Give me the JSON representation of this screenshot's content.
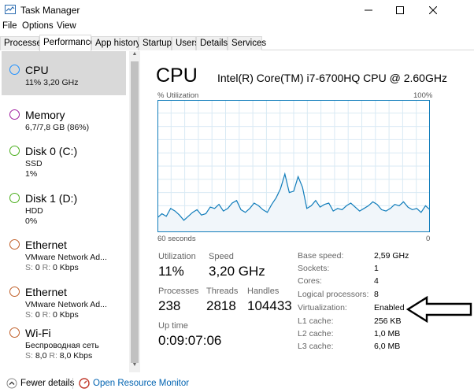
{
  "window": {
    "title": "Task Manager",
    "controls": {
      "minimize": "—",
      "maximize": "☐",
      "close": "✕"
    }
  },
  "menu": {
    "items": [
      "File",
      "Options",
      "View"
    ]
  },
  "tabs": [
    "Processes",
    "Performance",
    "App history",
    "Startup",
    "Users",
    "Details",
    "Services"
  ],
  "active_tab": "Performance",
  "sidebar": {
    "items": [
      {
        "title": "CPU",
        "sub1": "11%  3,20 GHz",
        "sub2": "",
        "color": "#1e90ff",
        "selected": true
      },
      {
        "title": "Memory",
        "sub1": "6,7/7,8 GB (86%)",
        "sub2": "",
        "color": "#a020a0"
      },
      {
        "title": "Disk 0 (C:)",
        "sub1": "SSD",
        "sub2": "1%",
        "color": "#4caf1e"
      },
      {
        "title": "Disk 1 (D:)",
        "sub1": "HDD",
        "sub2": "0%",
        "color": "#4caf1e"
      },
      {
        "title": "Ethernet",
        "sub1": "VMware Network Ad...",
        "sub2_label": "S:",
        "sub2_a": " 0  ",
        "sub2_label2": "R:",
        "sub2_b": " 0 Kbps",
        "color": "#c0602a"
      },
      {
        "title": "Ethernet",
        "sub1": "VMware Network Ad...",
        "sub2_label": "S:",
        "sub2_a": " 0  ",
        "sub2_label2": "R:",
        "sub2_b": " 0 Kbps",
        "color": "#c0602a"
      },
      {
        "title": "Wi-Fi",
        "sub1": "Беспроводная сеть",
        "sub2_label": "S:",
        "sub2_a": " 8,0  ",
        "sub2_label2": "R:",
        "sub2_b": " 8,0 Kbps",
        "color": "#c0602a"
      }
    ]
  },
  "main": {
    "heading": "CPU",
    "model": "Intel(R) Core(TM) i7-6700HQ CPU @ 2.60GHz",
    "axis": {
      "top_left": "% Utilization",
      "top_right": "100%",
      "bottom_left": "60 seconds",
      "bottom_right": "0"
    },
    "stats": {
      "utilization_label": "Utilization",
      "utilization": "11%",
      "speed_label": "Speed",
      "speed": "3,20 GHz",
      "processes_label": "Processes",
      "processes": "238",
      "threads_label": "Threads",
      "threads": "2818",
      "handles_label": "Handles",
      "handles": "104433",
      "uptime_label": "Up time",
      "uptime": "0:09:07:06"
    },
    "info": [
      {
        "label": "Base speed:",
        "value": "2,59 GHz"
      },
      {
        "label": "Sockets:",
        "value": "1"
      },
      {
        "label": "Cores:",
        "value": "4"
      },
      {
        "label": "Logical processors:",
        "value": "8"
      },
      {
        "label": "Virtualization:",
        "value": "Enabled"
      },
      {
        "label": "L1 cache:",
        "value": "256 KB"
      },
      {
        "label": "L2 cache:",
        "value": "1,0 MB"
      },
      {
        "label": "L3 cache:",
        "value": "6,0 MB"
      }
    ],
    "graph_colors": {
      "line": "#117dbb",
      "fill": "#f1f6fa",
      "grid": "#d9eaf4",
      "border": "#117dbb"
    }
  },
  "chart_data": {
    "type": "area",
    "ylim": [
      0,
      100
    ],
    "x_unit": "seconds",
    "values": [
      11,
      14,
      12,
      18,
      16,
      13,
      9,
      12,
      15,
      17,
      13,
      14,
      19,
      18,
      21,
      16,
      18,
      22,
      24,
      17,
      15,
      18,
      22,
      20,
      17,
      15,
      21,
      26,
      33,
      44,
      30,
      31,
      42,
      34,
      18,
      20,
      24,
      19,
      21,
      22,
      16,
      18,
      17,
      20,
      22,
      19,
      16,
      18,
      20,
      23,
      21,
      17,
      16,
      18,
      21,
      20,
      23,
      19,
      17,
      18,
      15,
      20,
      17
    ]
  },
  "bottom": {
    "fewer_details": "Fewer details",
    "open_monitor": "Open Resource Monitor"
  }
}
